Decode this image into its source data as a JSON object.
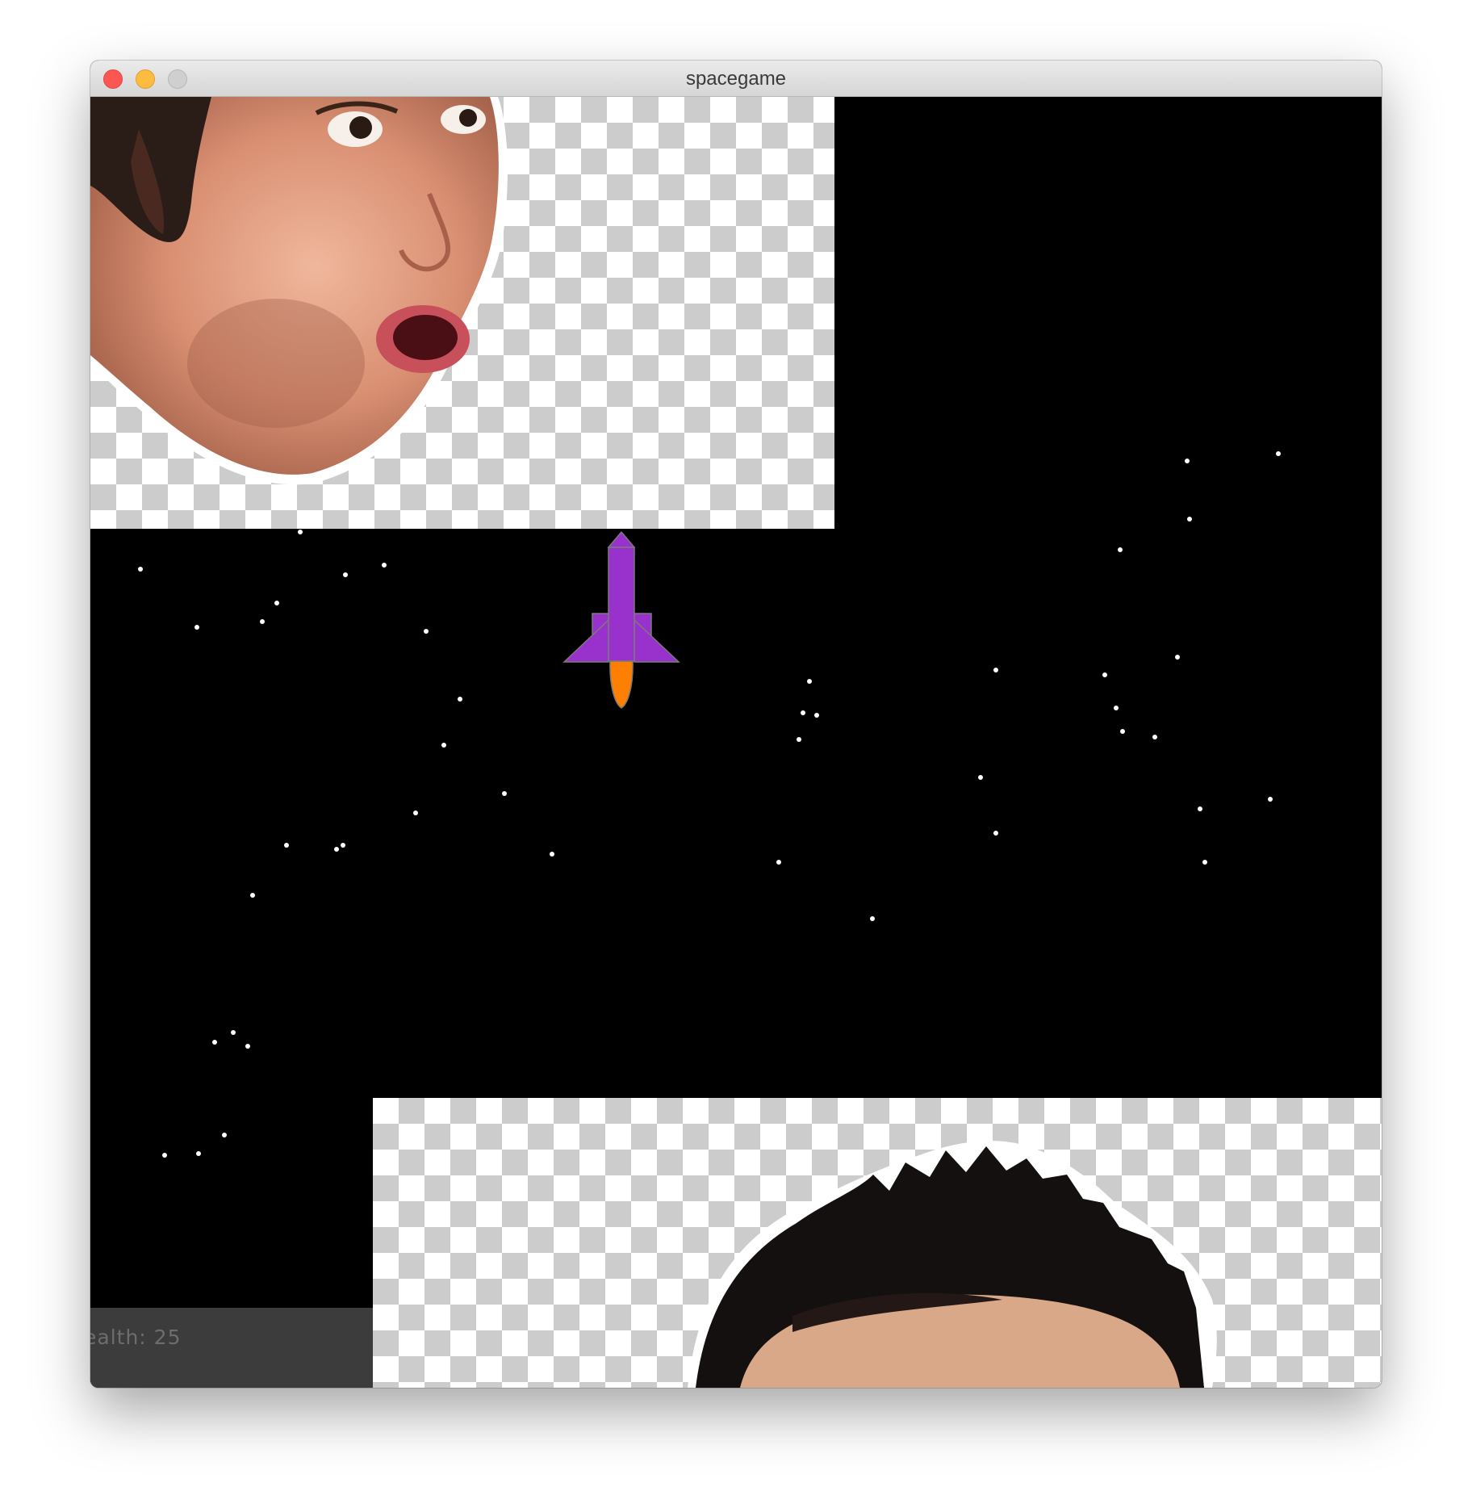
{
  "window": {
    "title": "spacegame",
    "controls": [
      "close",
      "minimize",
      "zoom"
    ]
  },
  "hud": {
    "health_text": "ealth: 25"
  },
  "colors": {
    "space": "#000000",
    "star": "#ffffff",
    "ship_body": "#9932cc",
    "ship_flame": "#ff7f00",
    "hud_background": "#3c3c3c",
    "hud_text": "#6d6d6d"
  },
  "sprites": [
    {
      "id": "enemy-face-top",
      "content": "surprised face sticker on transparent checkerboard"
    },
    {
      "id": "enemy-face-bottom",
      "content": "spiky dark hair sticker on transparent checkerboard"
    }
  ],
  "player": {
    "icon": "rocket-ship-icon"
  }
}
